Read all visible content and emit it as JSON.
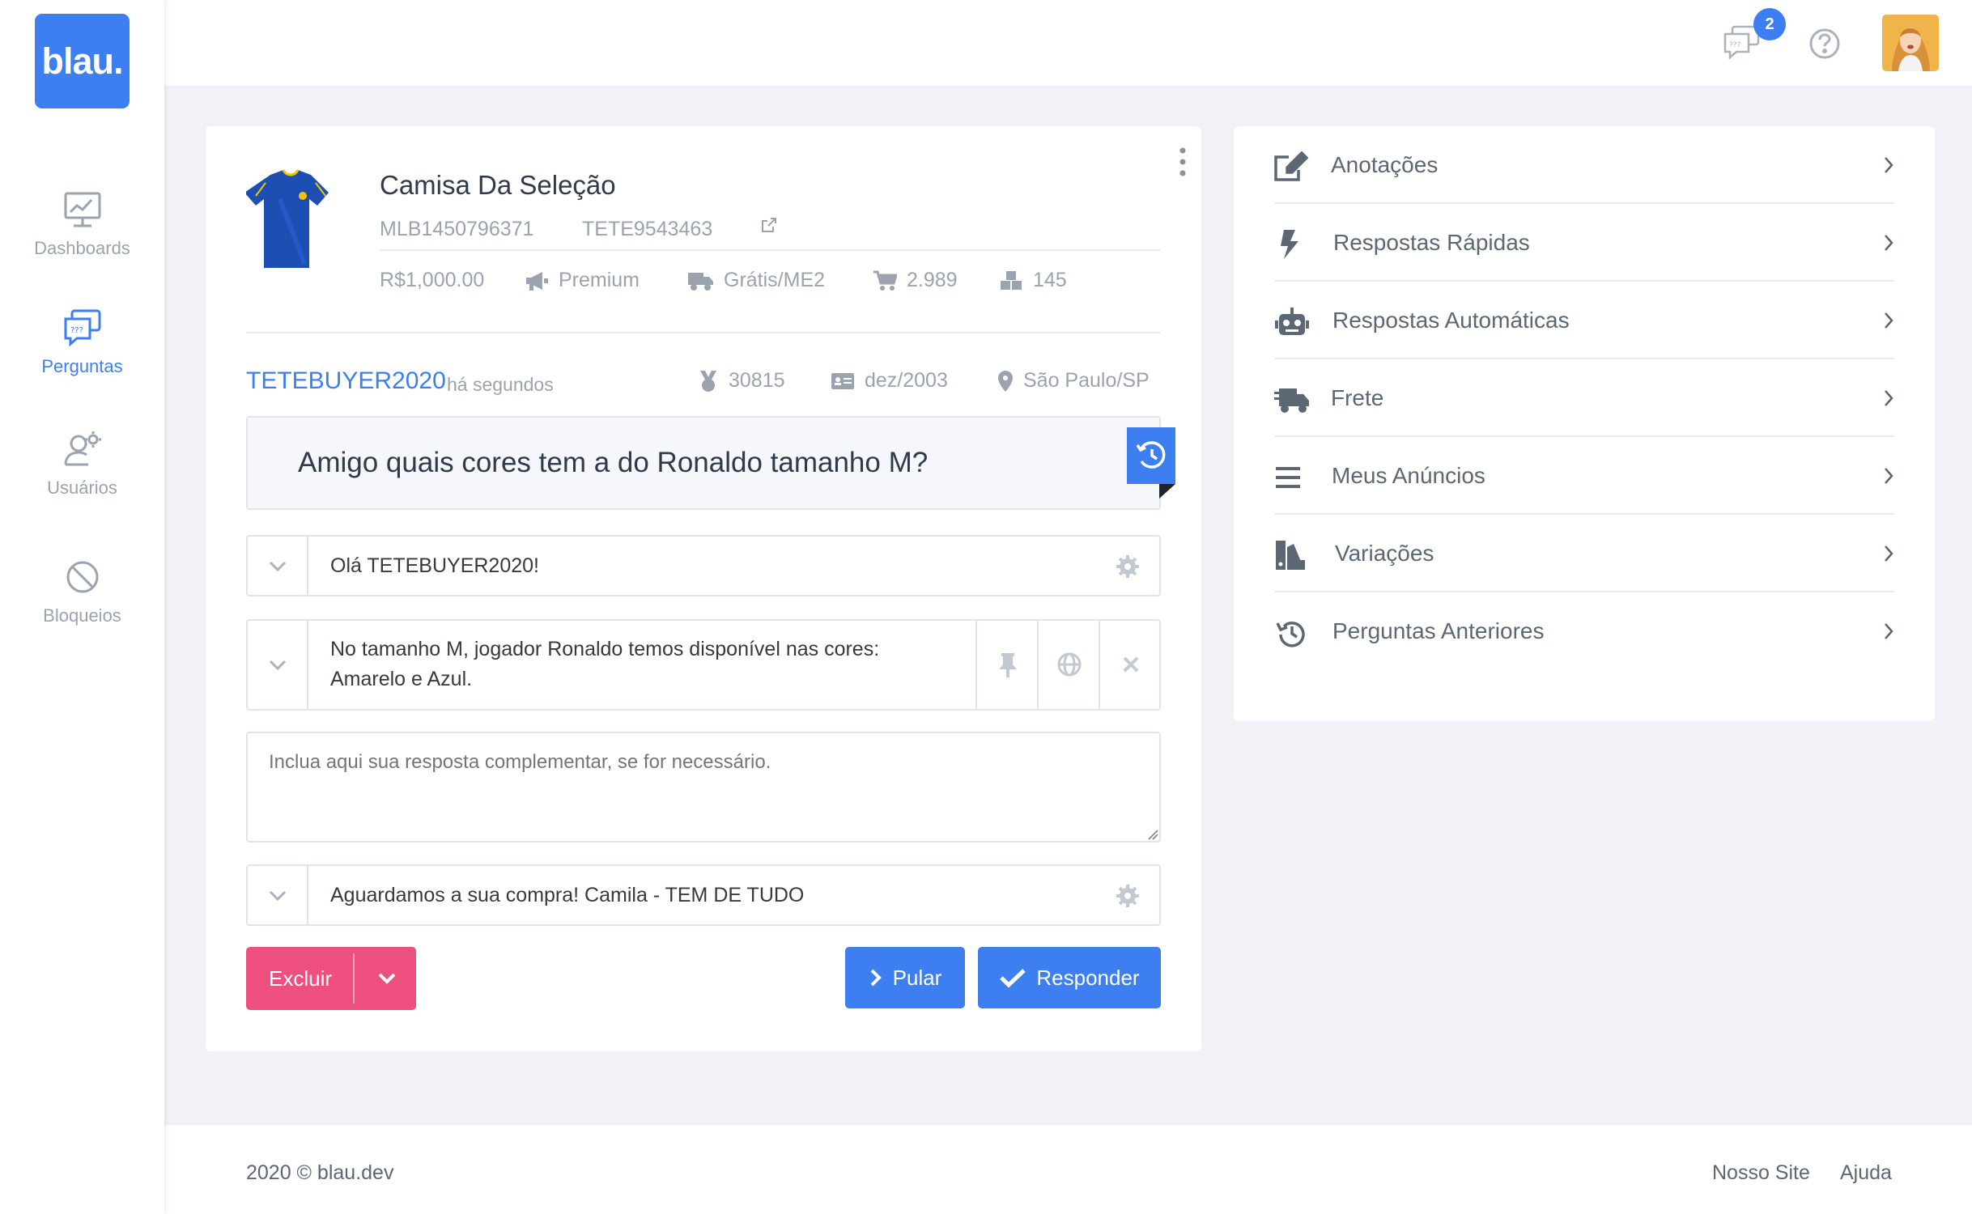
{
  "app": {
    "logo_text": "blau."
  },
  "sidebar": {
    "items": [
      {
        "label": "Dashboards",
        "icon": "chart-monitor-icon",
        "active": false
      },
      {
        "label": "Perguntas",
        "icon": "chat-questions-icon",
        "active": true
      },
      {
        "label": "Usuários",
        "icon": "user-gear-icon",
        "active": false
      },
      {
        "label": "Bloqueios",
        "icon": "block-icon",
        "active": false
      }
    ]
  },
  "topbar": {
    "notifications_count": "2",
    "notification_icon": "chat-questions-icon",
    "help_icon": "help-circle-icon",
    "avatar": "user-avatar"
  },
  "product": {
    "title": "Camisa Da Seleção",
    "mlb_id": "MLB1450796371",
    "sku": "TETE9543463",
    "price": "R$1,000.00",
    "listing_type": "Premium",
    "shipping": "Grátis/ME2",
    "sold": "2.989",
    "stock": "145"
  },
  "buyer": {
    "nickname": "TETEBUYER2020",
    "time": "há segundos",
    "points": "30815",
    "since": "dez/2003",
    "location": "São Paulo/SP"
  },
  "question": {
    "text": "Amigo quais cores tem a do Ronaldo tamanho M?"
  },
  "answer": {
    "greeting": "Olá TETEBUYER2020!",
    "body_line1": "No tamanho M, jogador Ronaldo temos disponível nas cores:",
    "body_line2": "Amarelo e Azul.",
    "complement_placeholder": "Inclua aqui sua resposta complementar, se for necessário.",
    "signature": "Aguardamos a sua compra! Camila - TEM DE TUDO"
  },
  "actions": {
    "delete_label": "Excluir",
    "skip_label": "Pular",
    "reply_label": "Responder"
  },
  "side_menu": {
    "items": [
      {
        "label": "Anotações",
        "icon": "edit-icon"
      },
      {
        "label": "Respostas Rápidas",
        "icon": "bolt-icon"
      },
      {
        "label": "Respostas Automáticas",
        "icon": "robot-icon"
      },
      {
        "label": "Frete",
        "icon": "truck-icon"
      },
      {
        "label": "Meus Anúncios",
        "icon": "list-icon"
      },
      {
        "label": "Variações",
        "icon": "swatch-icon"
      },
      {
        "label": "Perguntas Anteriores",
        "icon": "history-icon"
      }
    ]
  },
  "footer": {
    "copyright": "2020 © blau.dev",
    "link_site": "Nosso Site",
    "link_help": "Ajuda"
  },
  "colors": {
    "primary": "#3d7ef0",
    "danger": "#ed4f7e",
    "background": "#f1f2f7",
    "muted": "#9aa3ae"
  }
}
